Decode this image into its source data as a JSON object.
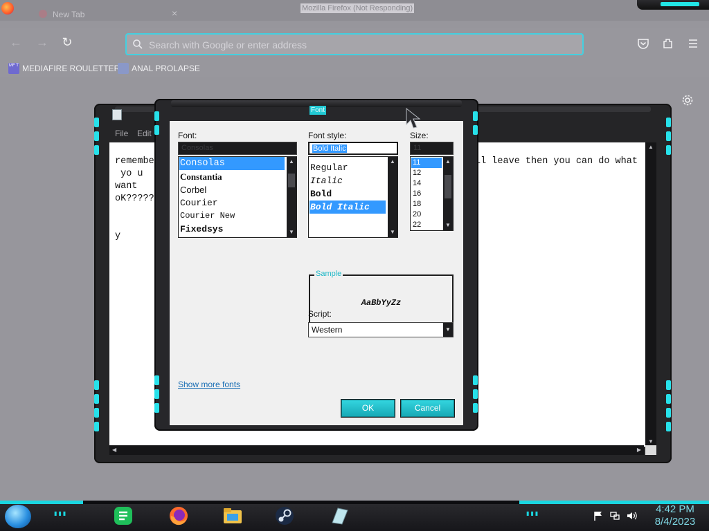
{
  "browser": {
    "tab_label": "New Tab",
    "tab_close": "×",
    "not_responding": "Mozilla Firefox (Not Responding)",
    "address_placeholder": "Search with Google or enter address",
    "icons": [
      "back-icon",
      "forward-icon",
      "reload-icon",
      "search-icon",
      "pocket-icon",
      "extensions-icon",
      "menu-icon",
      "settings-icon"
    ],
    "accent_color": "#44d0e0"
  },
  "bookmarks": [
    {
      "label": "MEDIAFIRE ROULETTER",
      "icon_text": "MF T"
    },
    {
      "label": "ANAL PROLAPSE",
      "icon_text": ""
    }
  ],
  "notepad": {
    "menu": {
      "file": "File",
      "edit": "Edit"
    },
    "lines": [
      "remember",
      " yo u",
      "want",
      "oK??????",
      "y"
    ],
    "line_1_right": "ll leave then you can do what"
  },
  "font_dialog": {
    "title": "Font",
    "font_label": "Font:",
    "style_label": "Font style:",
    "size_label": "Size:",
    "font_input_value": "Consolas",
    "style_input_value": "Bold Italic",
    "size_input_value": "11",
    "fonts": [
      "Consolas",
      "Constantia",
      "Corbel",
      "Courier",
      "Courier New",
      "Fixedsys"
    ],
    "styles": [
      "Regular",
      "Italic",
      "Bold",
      "Bold Italic"
    ],
    "sizes": [
      "11",
      "12",
      "14",
      "16",
      "18",
      "20",
      "22"
    ],
    "sample_caption": "Sample",
    "sample_text": "AaBbYyZz",
    "script_label": "Script:",
    "script_value": "Western",
    "show_more_fonts": "Show more fonts",
    "ok": "OK",
    "cancel": "Cancel",
    "accent_color": "#27e1ea"
  },
  "taskbar": {
    "apps": [
      "start-orb-icon",
      "notes-app-icon",
      "firefox-icon",
      "file-explorer-icon",
      "steam-icon",
      "notepad-app-icon"
    ],
    "tray_icons": [
      "flag-icon",
      "network-icon",
      "volume-icon"
    ],
    "time": "4:42 PM",
    "date": "8/4/2023",
    "accent_color": "#1ad6e0"
  }
}
